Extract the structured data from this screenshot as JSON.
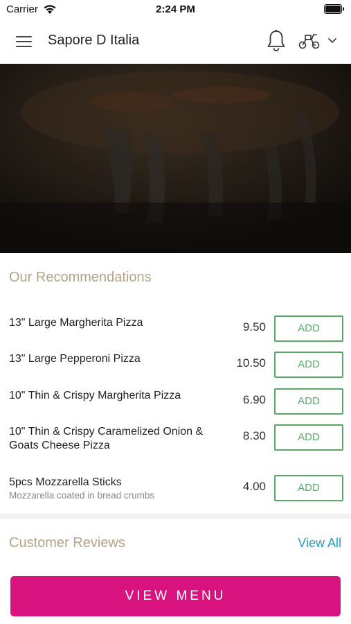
{
  "status_bar": {
    "carrier": "Carrier",
    "time": "2:24 PM",
    "wifi_icon": "wifi-icon",
    "battery_icon": "battery-icon"
  },
  "navbar": {
    "title": "Sapore D Italia",
    "menu_icon": "hamburger-menu-icon",
    "bell_icon": "bell-icon",
    "delivery_icon": "scooter-icon",
    "dropdown_icon": "chevron-down-icon"
  },
  "recommendations": {
    "title": "Our Recommendations",
    "items": [
      {
        "name": "13\" Large Margherita Pizza",
        "description": "",
        "price": "9.50",
        "button": "ADD"
      },
      {
        "name": "13\" Large Pepperoni Pizza",
        "description": "",
        "price": "10.50",
        "button": "ADD"
      },
      {
        "name": "10\" Thin & Crispy Margherita Pizza",
        "description": "",
        "price": "6.90",
        "button": "ADD"
      },
      {
        "name": "10\" Thin & Crispy Caramelized Onion & Goats Cheese Pizza",
        "description": "",
        "price": "8.30",
        "button": "ADD"
      },
      {
        "name": "5pcs Mozzarella Sticks",
        "description": "Mozzarella coated in bread crumbs",
        "price": "4.00",
        "button": "ADD"
      }
    ]
  },
  "reviews": {
    "title": "Customer Reviews",
    "view_all": "View All"
  },
  "cta": {
    "label": "VIEW MENU"
  },
  "colors": {
    "section_title": "#b6a384",
    "add_button": "#59a868",
    "link": "#2a9dc5",
    "cta": "#d8127f"
  }
}
